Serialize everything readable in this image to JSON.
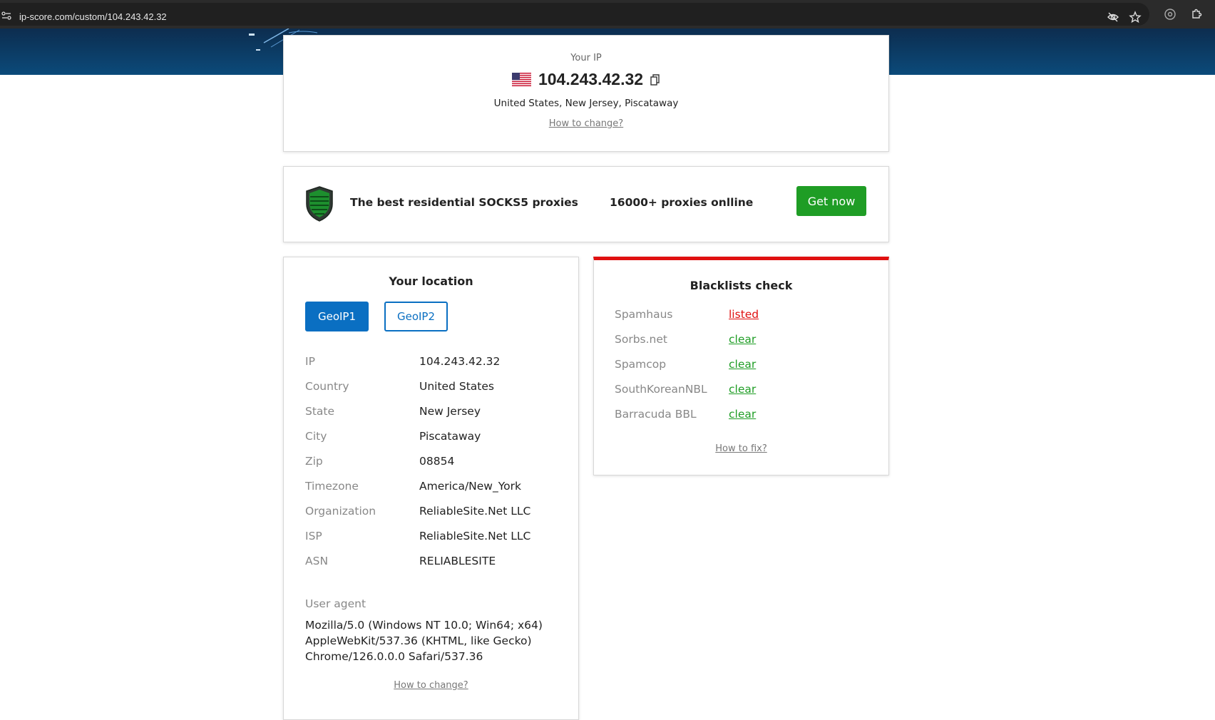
{
  "browser": {
    "url": "ip-score.com/custom/104.243.42.32",
    "icons": [
      "site-info-icon",
      "eye-off-icon",
      "star-icon",
      "extension-icon",
      "puzzle-icon"
    ]
  },
  "ip_card": {
    "caption": "Your IP",
    "flag": "us-flag-icon",
    "ip": "104.243.42.32",
    "location": "United States, New Jersey, Piscataway",
    "change_link": "How to change?"
  },
  "promo": {
    "title": "The best residential SOCKS5 proxies",
    "count": "16000+ proxies onlline",
    "button": "Get now",
    "button_color": "#1f9d25"
  },
  "location": {
    "title": "Your location",
    "tabs": [
      {
        "label": "GeoIP1",
        "active": true
      },
      {
        "label": "GeoIP2",
        "active": false
      }
    ],
    "rows": [
      {
        "label": "IP",
        "value": "104.243.42.32"
      },
      {
        "label": "Country",
        "value": "United States"
      },
      {
        "label": "State",
        "value": "New Jersey"
      },
      {
        "label": "City",
        "value": "Piscataway"
      },
      {
        "label": "Zip",
        "value": "08854"
      },
      {
        "label": "Timezone",
        "value": "America/New_York"
      },
      {
        "label": "Organization",
        "value": "ReliableSite.Net LLC"
      },
      {
        "label": "ISP",
        "value": "ReliableSite.Net LLC"
      },
      {
        "label": "ASN",
        "value": "RELIABLESITE"
      }
    ],
    "user_agent_label": "User agent",
    "user_agent": "Mozilla/5.0 (Windows NT 10.0; Win64; x64) AppleWebKit/537.36 (KHTML, like Gecko) Chrome/126.0.0.0 Safari/537.36",
    "change_link": "How to change?",
    "accent_color": "#0a6fc2"
  },
  "blacklists": {
    "title": "Blacklists check",
    "rows": [
      {
        "name": "Spamhaus",
        "status": "listed"
      },
      {
        "name": "Sorbs.net",
        "status": "clear"
      },
      {
        "name": "Spamcop",
        "status": "clear"
      },
      {
        "name": "SouthKoreanNBL",
        "status": "clear"
      },
      {
        "name": "Barracuda BBL",
        "status": "clear"
      }
    ],
    "fix_link": "How to fix?",
    "listed_color": "#e01010",
    "clear_color": "#1f9d25"
  }
}
